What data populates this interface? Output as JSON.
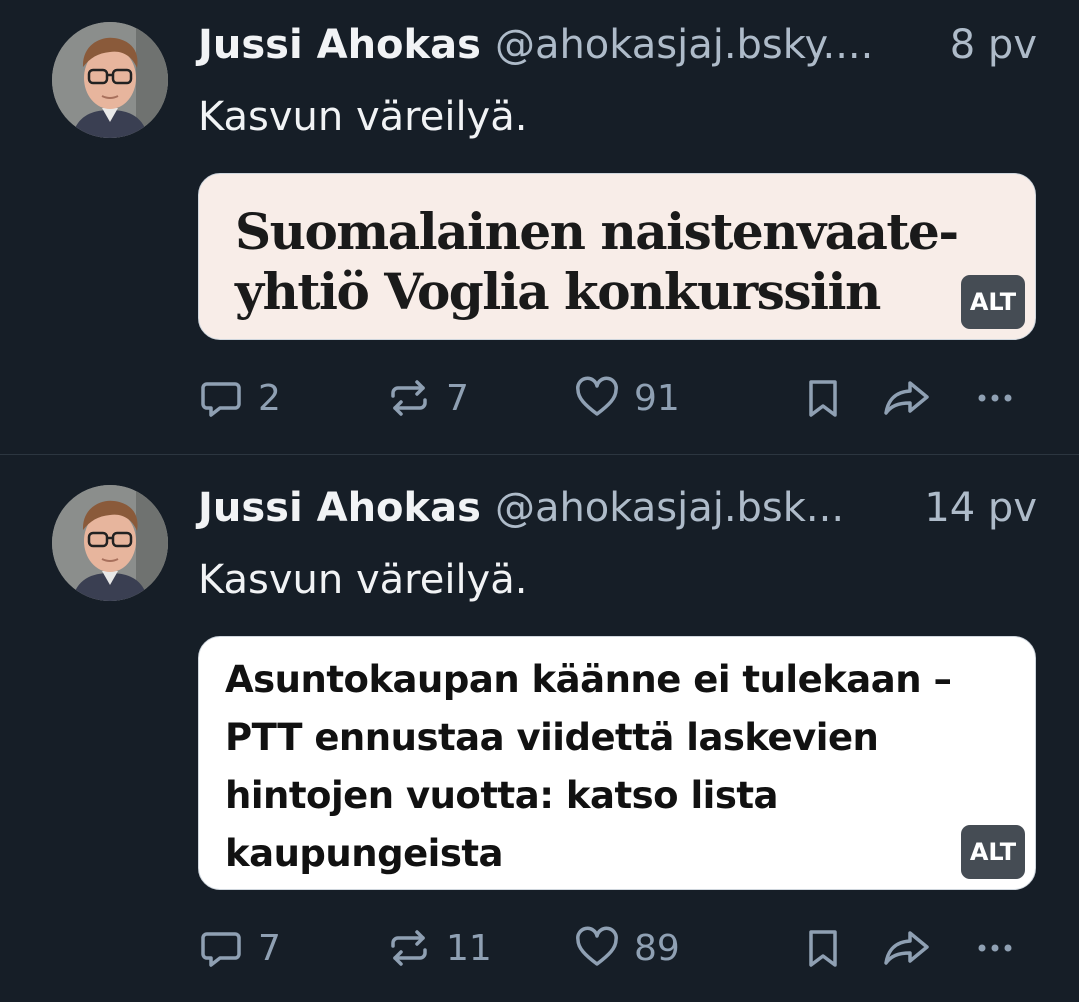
{
  "posts": [
    {
      "author": "Jussi Ahokas",
      "handle": "@ahokasjaj.bsky....",
      "age": "8 pv",
      "text": "Kasvun väreilyä.",
      "embed_headline": "Suomalainen naistenvaate-yhtiö Voglia konkurssiin",
      "alt_label": "ALT",
      "counts": {
        "replies": "2",
        "reposts": "7",
        "likes": "91"
      }
    },
    {
      "author": "Jussi Ahokas",
      "handle": "@ahokasjaj.bsk...",
      "age": "14 pv",
      "text": "Kasvun väreilyä.",
      "embed_headline": "Asuntokaupan käänne ei tulekaan – PTT ennustaa viidettä laskevien hintojen vuotta: katso lista kaupungeista",
      "alt_label": "ALT",
      "counts": {
        "replies": "7",
        "reposts": "11",
        "likes": "89"
      }
    }
  ]
}
